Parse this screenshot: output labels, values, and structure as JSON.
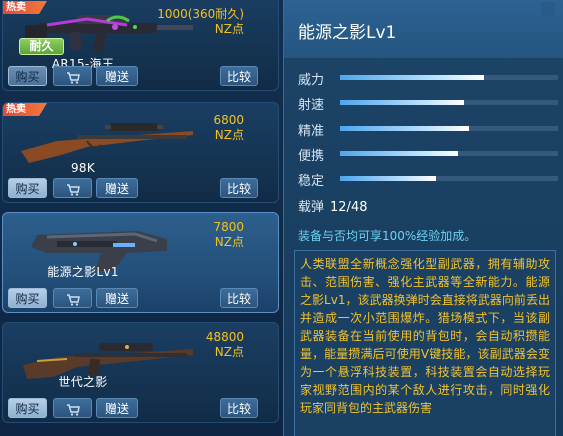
{
  "items": [
    {
      "name": "AR15-海王",
      "price_value": "1000(360耐久)",
      "price_unit": "NZ点",
      "hot_label": "热卖",
      "durable_label": "耐久",
      "buy_label": "购买",
      "gift_label": "赠送",
      "compare_label": "比较"
    },
    {
      "name": "98K",
      "price_value": "6800",
      "price_unit": "NZ点",
      "hot_label": "热卖",
      "buy_label": "购买",
      "gift_label": "赠送",
      "compare_label": "比较"
    },
    {
      "name": "能源之影Lv1",
      "price_value": "7800",
      "price_unit": "NZ点",
      "buy_label": "购买",
      "gift_label": "赠送",
      "compare_label": "比较"
    },
    {
      "name": "世代之影",
      "price_value": "48800",
      "price_unit": "NZ点",
      "buy_label": "购买",
      "gift_label": "赠送",
      "compare_label": "比较"
    }
  ],
  "detail": {
    "title": "能源之影Lv1",
    "stats": [
      {
        "label": "威力",
        "fraction": 0.66
      },
      {
        "label": "射速",
        "fraction": 0.57
      },
      {
        "label": "精准",
        "fraction": 0.59
      },
      {
        "label": "便携",
        "fraction": 0.54
      },
      {
        "label": "稳定",
        "fraction": 0.44
      }
    ],
    "ammo_label": "载弹",
    "ammo_value": "12/48",
    "exp_note": "装备与否均可享100%经验加成。",
    "description": "人类联盟全新概念强化型副武器，拥有辅助攻击、范围伤害、强化主武器等全新能力。能源之影Lv1，该武器换弹时会直接将武器向前丢出并造成一次小范围爆炸。猎场模式下，当该副武器装备在当前使用的背包时，会自动积攒能量，能量攒满后可使用V键技能，该副武器会变为一个悬浮科技装置，科技装置会自动选择玩家视野范围内的某个敌人进行攻击，同时强化玩家同背包的主武器伤害"
  },
  "colors": {
    "price": "#f4c21e",
    "description": "#f3c32b",
    "exp_note": "#6fd2ef",
    "hot_badge": "#e6473a",
    "durable_badge": "#6cb845"
  }
}
